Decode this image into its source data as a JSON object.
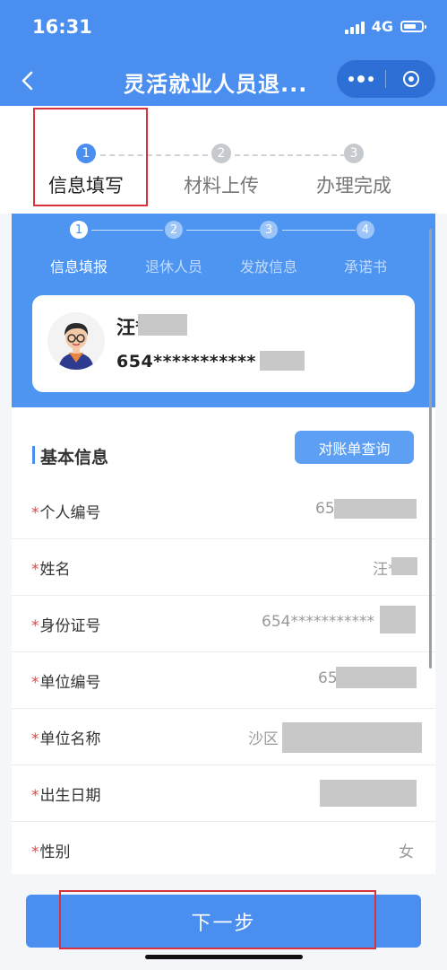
{
  "status_bar": {
    "time": "16:31",
    "network": "4G"
  },
  "nav": {
    "title": "灵活就业人员退..."
  },
  "main_steps": [
    {
      "num": "1",
      "label": "信息填写"
    },
    {
      "num": "2",
      "label": "材料上传"
    },
    {
      "num": "3",
      "label": "办理完成"
    }
  ],
  "sub_steps": [
    {
      "num": "1",
      "label": "信息填报"
    },
    {
      "num": "2",
      "label": "退休人员"
    },
    {
      "num": "3",
      "label": "发放信息"
    },
    {
      "num": "4",
      "label": "承诺书"
    }
  ],
  "profile": {
    "name": "汪*",
    "id_number": "654***********"
  },
  "section": {
    "title": "基本信息",
    "query_button": "对账单查询"
  },
  "fields": [
    {
      "label": "个人编号",
      "value": "65"
    },
    {
      "label": "姓名",
      "value": "汪*"
    },
    {
      "label": "身份证号",
      "value": "654***********"
    },
    {
      "label": "单位编号",
      "value": "65"
    },
    {
      "label": "单位名称",
      "value": "沙区"
    },
    {
      "label": "出生日期",
      "value": ""
    },
    {
      "label": "性别",
      "value": "女"
    }
  ],
  "required_mark": "*",
  "footer": {
    "next_button": "下一步"
  },
  "colors": {
    "primary": "#4a8ef0",
    "highlight": "#d8323f",
    "required": "#e04848"
  }
}
